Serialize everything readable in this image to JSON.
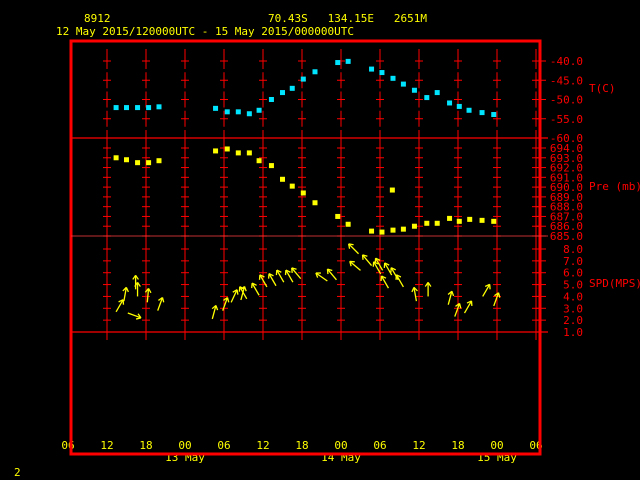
{
  "header": {
    "station": "8912",
    "location": "70.43S   134.15E   2651M",
    "period": "12 May 2015/120000UTC - 15 May 2015/000000UTC"
  },
  "footer": {
    "page": "2"
  },
  "colors": {
    "frame": "#ff0000",
    "text": "#ffff00",
    "temp": "#00e5ff",
    "pressure": "#ffff00",
    "wind": "#ffff00",
    "grid_alt": "#808080"
  },
  "chart_data": {
    "type": "scatter",
    "time_unit": "hours since 12 May 2015 00UTC",
    "xlim": [
      6,
      78
    ],
    "x_ticks": [
      {
        "h": 6,
        "label": "06"
      },
      {
        "h": 12,
        "label": "12"
      },
      {
        "h": 18,
        "label": "18"
      },
      {
        "h": 24,
        "label": "00"
      },
      {
        "h": 30,
        "label": "06"
      },
      {
        "h": 36,
        "label": "12"
      },
      {
        "h": 42,
        "label": "18"
      },
      {
        "h": 48,
        "label": "00"
      },
      {
        "h": 54,
        "label": "06"
      },
      {
        "h": 60,
        "label": "12"
      },
      {
        "h": 66,
        "label": "18"
      },
      {
        "h": 72,
        "label": "00"
      },
      {
        "h": 78,
        "label": "06"
      }
    ],
    "day_labels": [
      {
        "h": 24,
        "label": "13 May"
      },
      {
        "h": 48,
        "label": "14 May"
      },
      {
        "h": 72,
        "label": "15 May"
      }
    ],
    "panels": [
      {
        "name": "temperature",
        "ylabel": "T(C)",
        "ylim": [
          -60,
          -40
        ],
        "ticks": [
          "-40.0",
          "-45.0",
          "-50.0",
          "-55.0",
          "-60.0"
        ],
        "tick_values": [
          -40,
          -45,
          -50,
          -55,
          -60
        ],
        "series": [
          [
            13.4,
            -52.1
          ],
          [
            15.0,
            -52.1
          ],
          [
            16.7,
            -52.1
          ],
          [
            18.4,
            -52.1
          ],
          [
            20.0,
            -51.9
          ],
          [
            28.7,
            -52.3
          ],
          [
            30.5,
            -53.2
          ],
          [
            32.2,
            -53.2
          ],
          [
            33.9,
            -53.7
          ],
          [
            35.4,
            -52.8
          ],
          [
            37.3,
            -50.0
          ],
          [
            39.0,
            -48.2
          ],
          [
            40.5,
            -47.1
          ],
          [
            42.2,
            -44.7
          ],
          [
            44.0,
            -42.8
          ],
          [
            47.5,
            -40.4
          ],
          [
            49.1,
            -40.1
          ],
          [
            52.7,
            -42.1
          ],
          [
            54.3,
            -43.0
          ],
          [
            56.0,
            -44.5
          ],
          [
            57.6,
            -46.0
          ],
          [
            59.3,
            -47.6
          ],
          [
            61.2,
            -49.5
          ],
          [
            62.8,
            -48.2
          ],
          [
            64.7,
            -50.9
          ],
          [
            66.2,
            -51.8
          ],
          [
            67.7,
            -52.8
          ],
          [
            69.7,
            -53.4
          ],
          [
            71.5,
            -53.9
          ]
        ]
      },
      {
        "name": "pressure",
        "ylabel": "Pre (mb)",
        "ylim": [
          685,
          694
        ],
        "ticks": [
          "694.0",
          "693.0",
          "692.0",
          "691.0",
          "690.0",
          "689.0",
          "688.0",
          "687.0",
          "686.0",
          "685.0"
        ],
        "tick_values": [
          694,
          693,
          692,
          691,
          690,
          689,
          688,
          687,
          686,
          685
        ],
        "series": [
          [
            13.4,
            693.0
          ],
          [
            15.0,
            692.8
          ],
          [
            16.7,
            692.5
          ],
          [
            18.4,
            692.5
          ],
          [
            20.0,
            692.7
          ],
          [
            28.7,
            693.7
          ],
          [
            30.5,
            693.9
          ],
          [
            32.2,
            693.5
          ],
          [
            33.9,
            693.5
          ],
          [
            35.4,
            692.7
          ],
          [
            37.3,
            692.2
          ],
          [
            39.0,
            690.8
          ],
          [
            40.5,
            690.1
          ],
          [
            42.2,
            689.4
          ],
          [
            44.0,
            688.4
          ],
          [
            47.5,
            687.0
          ],
          [
            49.1,
            686.2
          ],
          [
            52.7,
            685.5
          ],
          [
            54.3,
            685.4
          ],
          [
            55.9,
            689.7
          ],
          [
            56.0,
            685.6
          ],
          [
            57.6,
            685.7
          ],
          [
            59.3,
            686.0
          ],
          [
            61.2,
            686.3
          ],
          [
            62.8,
            686.3
          ],
          [
            64.7,
            686.8
          ],
          [
            66.2,
            686.5
          ],
          [
            67.8,
            686.7
          ],
          [
            69.7,
            686.6
          ],
          [
            71.5,
            686.5
          ]
        ]
      },
      {
        "name": "wind",
        "ylabel": "SPD(MPS)",
        "ylim": [
          1,
          8
        ],
        "ticks": [
          "8.0",
          "7.0",
          "6.0",
          "5.0",
          "4.0",
          "3.0",
          "2.0",
          "1.0"
        ],
        "tick_values": [
          8,
          7,
          6,
          5,
          4,
          3,
          2,
          1
        ],
        "series_note": "[hour, speed m/s, arrow bearing deg]",
        "series": [
          [
            13.4,
            2.7,
            30
          ],
          [
            14.6,
            3.6,
            10
          ],
          [
            15.2,
            2.6,
            110
          ],
          [
            16.4,
            4.6,
            0
          ],
          [
            16.7,
            4.0,
            0
          ],
          [
            18.2,
            3.5,
            5
          ],
          [
            19.8,
            2.8,
            20
          ],
          [
            28.2,
            2.1,
            15
          ],
          [
            29.8,
            2.8,
            20
          ],
          [
            31.1,
            3.5,
            25
          ],
          [
            32.6,
            3.7,
            15
          ],
          [
            33.5,
            3.8,
            330
          ],
          [
            35.4,
            4.1,
            330
          ],
          [
            36.6,
            4.8,
            330
          ],
          [
            38.0,
            4.9,
            330
          ],
          [
            39.2,
            5.2,
            330
          ],
          [
            40.6,
            5.2,
            330
          ],
          [
            41.8,
            5.5,
            320
          ],
          [
            45.9,
            5.3,
            305
          ],
          [
            47.3,
            5.4,
            320
          ],
          [
            50.7,
            7.6,
            315
          ],
          [
            51.0,
            6.2,
            310
          ],
          [
            52.7,
            6.6,
            320
          ],
          [
            54.1,
            5.9,
            330
          ],
          [
            54.4,
            6.2,
            330
          ],
          [
            55.3,
            4.7,
            330
          ],
          [
            55.8,
            5.8,
            330
          ],
          [
            56.8,
            5.4,
            330
          ],
          [
            57.6,
            4.8,
            330
          ],
          [
            59.6,
            3.6,
            350
          ],
          [
            61.4,
            4.0,
            0
          ],
          [
            64.5,
            3.3,
            15
          ],
          [
            65.5,
            2.3,
            20
          ],
          [
            67.0,
            2.6,
            30
          ],
          [
            69.8,
            4.0,
            30
          ],
          [
            71.5,
            3.2,
            20
          ]
        ]
      }
    ]
  }
}
